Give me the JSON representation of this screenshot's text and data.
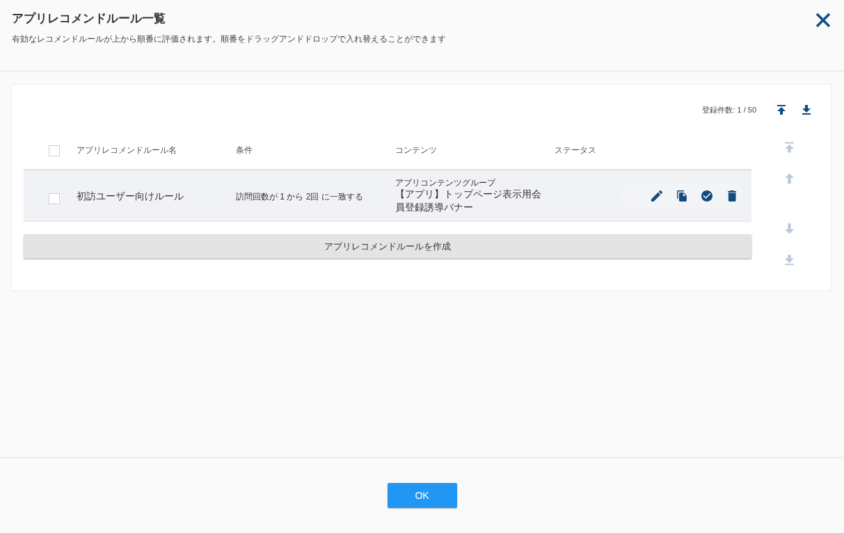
{
  "header": {
    "title": "アプリレコメンドルール一覧",
    "description": "有効なレコメンドルールが上から順番に評価されます。順番をドラッグアンドドロップで入れ替えることができます"
  },
  "toolbar": {
    "record_count": "登録件数: 1 / 50",
    "buttons": [
      {
        "kind": "top",
        "disabled": false
      },
      {
        "kind": "bottom",
        "disabled": false
      }
    ]
  },
  "table": {
    "header_checked": false,
    "columns": [
      "アプリレコメンドルール名",
      "条件",
      "コンテンツ",
      "ステータス"
    ],
    "rows": [
      {
        "checked": false,
        "name": "初訪ユーザー向けルール",
        "condition": "訪問回数が 1 から 2回 に一致する",
        "content_group": "アプリコンテンツグループ",
        "content": "【アプリ】トップページ表示用会員登録誘導バナー",
        "actions": [
          {
            "kind": "edit"
          },
          {
            "kind": "copy"
          },
          {
            "kind": "check"
          },
          {
            "kind": "delete"
          }
        ]
      }
    ]
  },
  "move_buttons": [
    {
      "kind": "top",
      "disabled": true
    },
    {
      "kind": "up",
      "disabled": true
    },
    {
      "kind": "down",
      "disabled": true
    },
    {
      "kind": "bottom",
      "disabled": true
    }
  ],
  "create_button": "アプリレコメンドルールを作成",
  "footer": {
    "ok_button": "OK"
  }
}
